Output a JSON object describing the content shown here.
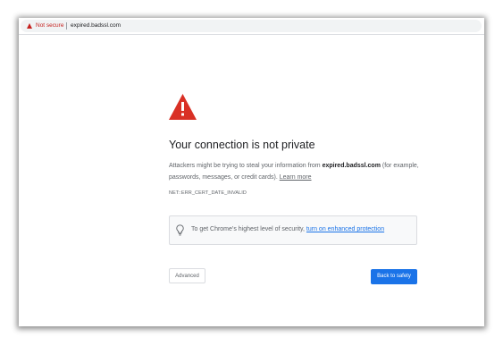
{
  "address_bar": {
    "security_label": "Not secure",
    "url": "expired.badssl.com",
    "security_icon": "warning-triangle-icon"
  },
  "interstitial": {
    "icon": "warning-triangle-icon",
    "title": "Your connection is not private",
    "desc_before": "Attackers might be trying to steal your information from ",
    "desc_domain": "expired.badssl.com",
    "desc_after": " (for example, passwords, messages, or credit cards). ",
    "learn_more": "Learn more",
    "error_code": "NET::ERR_CERT_DATE_INVALID"
  },
  "enhanced_protection": {
    "icon": "lightbulb-icon",
    "text": "To get Chrome’s highest level of security, ",
    "link": "turn on enhanced protection"
  },
  "buttons": {
    "advanced": "Advanced",
    "back": "Back to safety"
  },
  "colors": {
    "warning_red": "#c5221f",
    "accent_blue": "#1a73e8",
    "text_primary": "#202124",
    "text_secondary": "#5f6368"
  }
}
